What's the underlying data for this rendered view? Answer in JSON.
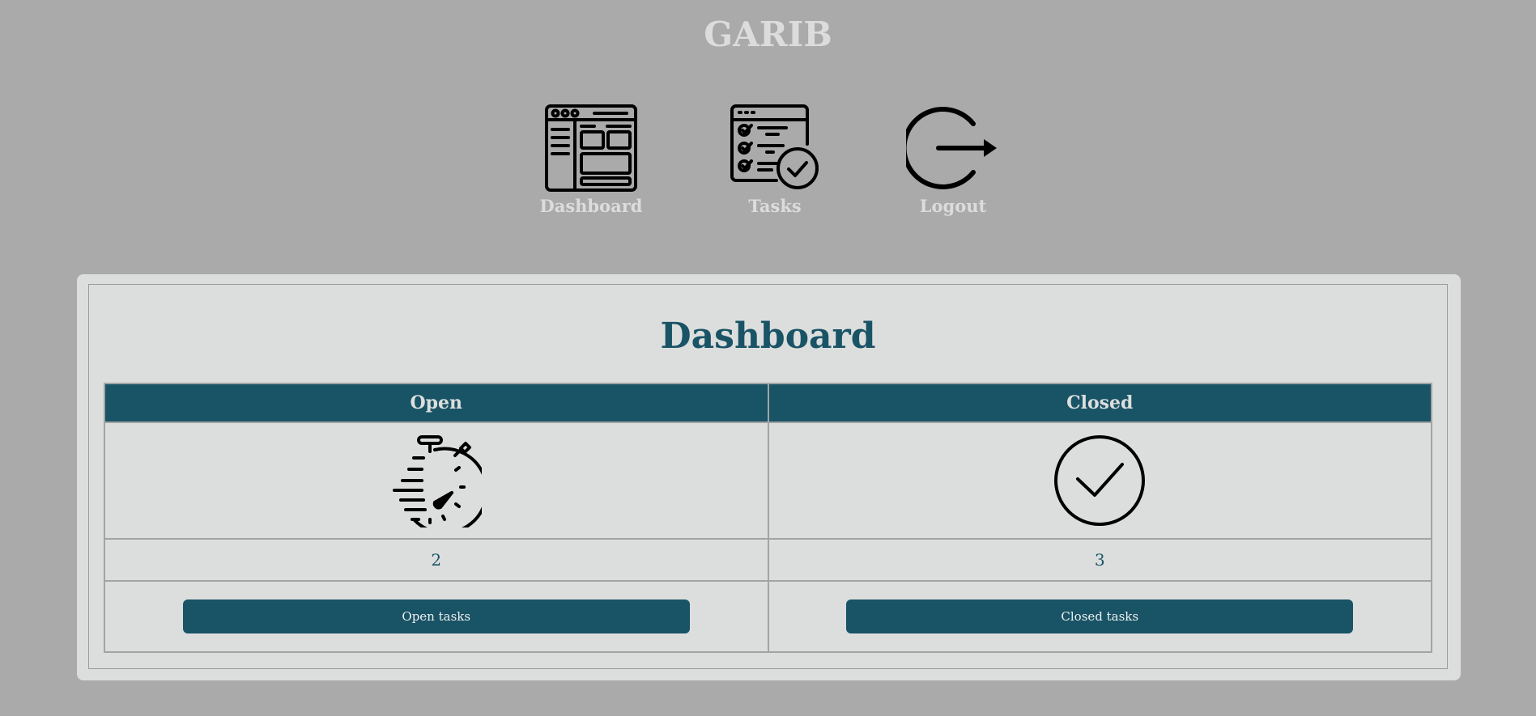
{
  "header": {
    "title": "GARIB"
  },
  "nav": [
    {
      "label": "Dashboard",
      "icon": "dashboard-layout-icon"
    },
    {
      "label": "Tasks",
      "icon": "task-checklist-icon"
    },
    {
      "label": "Logout",
      "icon": "logout-icon"
    }
  ],
  "main": {
    "title": "Dashboard",
    "columns": [
      {
        "header": "Open",
        "icon": "stopwatch-icon",
        "count": "2",
        "button_label": "Open tasks"
      },
      {
        "header": "Closed",
        "icon": "check-circle-icon",
        "count": "3",
        "button_label": "Closed tasks"
      }
    ]
  },
  "colors": {
    "page_background": "#aaaaaa",
    "panel_background": "#dcdedd",
    "accent": "#195366",
    "header_text": "#dcdcdc"
  }
}
